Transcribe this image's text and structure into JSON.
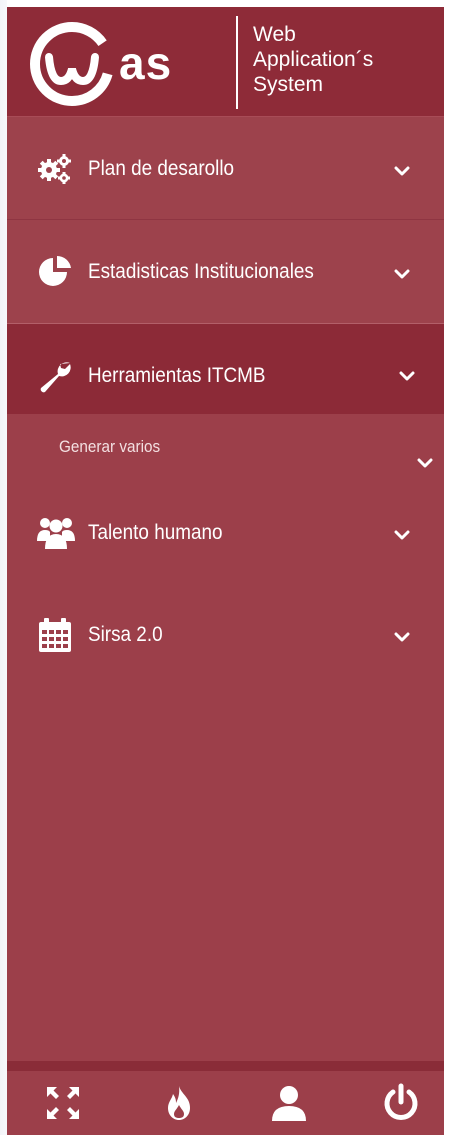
{
  "brand": {
    "short": "as",
    "line1": "Web",
    "line2": "Application´s",
    "line3": "System"
  },
  "colors": {
    "sidebar_bg": "#9c3f4a",
    "header_bg": "#8e2b38",
    "active_bg": "#8c2a37",
    "text": "#ffffff"
  },
  "menu": [
    {
      "label": "Plan de desarollo",
      "icon": "gears-icon"
    },
    {
      "label": "Estadisticas Institucionales",
      "icon": "pie-chart-icon"
    },
    {
      "label": "Herramientas ITCMB",
      "icon": "wrench-icon",
      "active": true
    },
    {
      "label": "Generar varios",
      "submenu": true
    },
    {
      "label": "Talento humano",
      "icon": "users-icon"
    },
    {
      "label": "Sirsa 2.0",
      "icon": "calendar-icon"
    }
  ],
  "footer": {
    "buttons": [
      "fullscreen-icon",
      "fire-icon",
      "user-icon",
      "power-icon"
    ]
  }
}
